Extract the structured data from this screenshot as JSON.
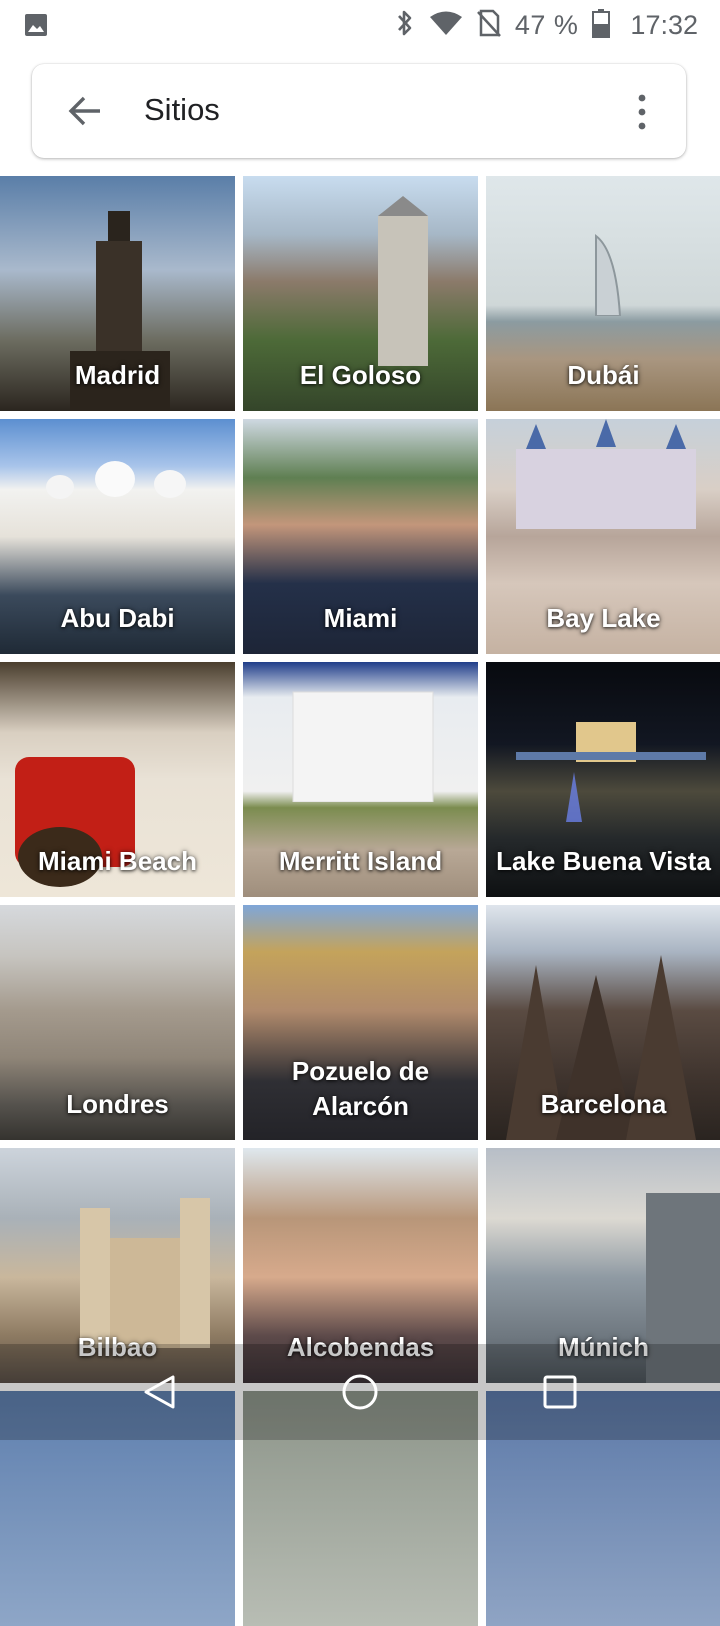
{
  "status_bar": {
    "battery_text": "47 %",
    "time": "17:32",
    "icons": [
      "gallery-icon",
      "bluetooth-icon",
      "wifi-icon",
      "no-sim-icon",
      "battery-icon"
    ]
  },
  "header": {
    "title": "Sitios",
    "back_icon": "arrow-left-icon",
    "menu_icon": "more-vert-icon"
  },
  "places": [
    {
      "label": "Madrid"
    },
    {
      "label": "El Goloso"
    },
    {
      "label": "Dubái"
    },
    {
      "label": "Abu Dabi"
    },
    {
      "label": "Miami"
    },
    {
      "label": "Bay Lake"
    },
    {
      "label": "Miami Beach"
    },
    {
      "label": "Merritt Island"
    },
    {
      "label": "Lake Buena Vista"
    },
    {
      "label": "Londres"
    },
    {
      "label": "Pozuelo de Alarcón"
    },
    {
      "label": "Barcelona"
    },
    {
      "label": "Bilbao"
    },
    {
      "label": "Alcobendas"
    },
    {
      "label": "Múnich"
    }
  ],
  "nav_bar": {
    "back_icon": "triangle-back-icon",
    "home_icon": "circle-home-icon",
    "recents_icon": "square-recents-icon"
  }
}
